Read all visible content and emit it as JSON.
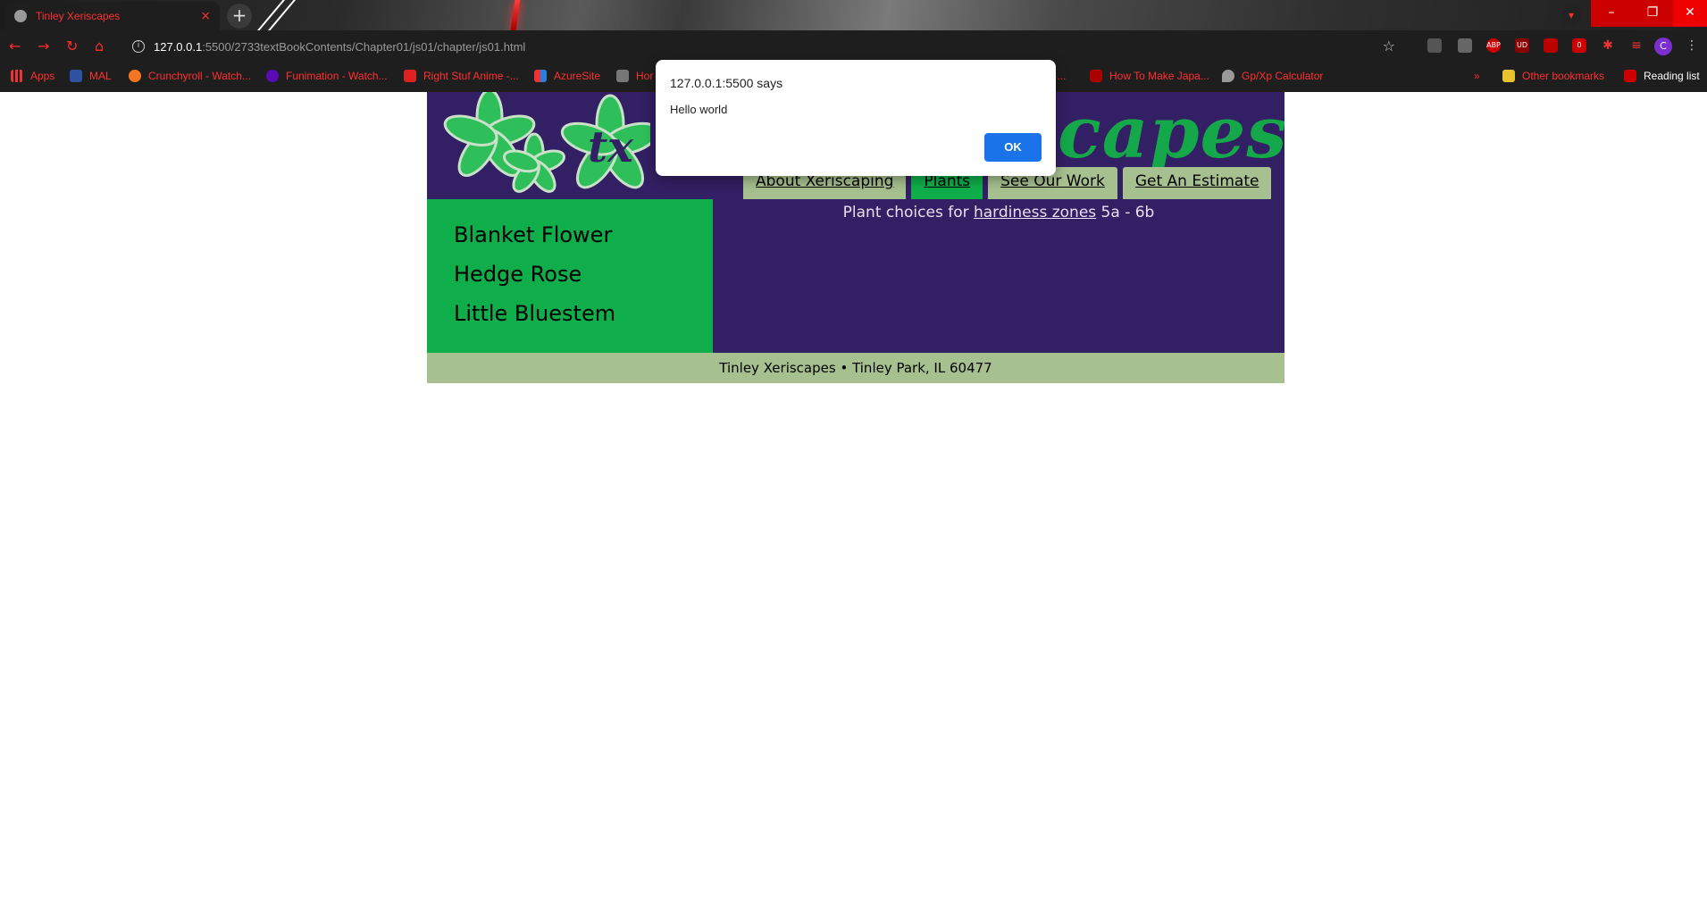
{
  "browser": {
    "tab_title": "Tinley Xeriscapes",
    "tab_close": "×",
    "new_tab": "+",
    "window_controls": {
      "minimize": "–",
      "restore": "❐",
      "close": "✕"
    },
    "url_host": "127.0.0.1",
    "url_rest": ":5500/2733textBookContents/Chapter01/js01/chapter/js01.html",
    "avatar_letter": "C",
    "extensions": [
      "ABP",
      "UD"
    ],
    "extension_badge": "0",
    "bookmarks": [
      {
        "label": "Apps"
      },
      {
        "label": "MAL"
      },
      {
        "label": "Crunchyroll - Watch..."
      },
      {
        "label": "Funimation - Watch..."
      },
      {
        "label": "Right Stuf Anime -..."
      },
      {
        "label": "AzureSite"
      },
      {
        "label": "Hor"
      },
      {
        "label": "s -..."
      },
      {
        "label": "How To Make Japa..."
      },
      {
        "label": "Gp/Xp Calculator"
      }
    ],
    "bookmarks_overflow": "»",
    "other_bookmarks": "Other bookmarks",
    "reading_list": "Reading list",
    "colors": {
      "accent": "#ff3030",
      "frame": "#1e1e1e"
    }
  },
  "site": {
    "logo_text": "scapes",
    "logo_monogram": "tx",
    "nav": [
      {
        "label": "About Xeriscaping",
        "active": false
      },
      {
        "label": "Plants",
        "active": true
      },
      {
        "label": "See Our Work",
        "active": false
      },
      {
        "label": "Get An Estimate",
        "active": false
      }
    ],
    "plants": [
      "Blanket Flower",
      "Hedge Rose",
      "Little Bluestem"
    ],
    "zones_prefix": "Plant choices for ",
    "zones_link": "hardiness zones",
    "zones_suffix": " 5a - 6b",
    "footer": "Tinley Xeriscapes • Tinley Park, IL 60477",
    "colors": {
      "purple": "#331f63",
      "green": "#0fae4b",
      "sage": "#a6c08f"
    }
  },
  "dialog": {
    "origin": "127.0.0.1:5500 says",
    "message": "Hello world",
    "ok_label": "OK"
  }
}
